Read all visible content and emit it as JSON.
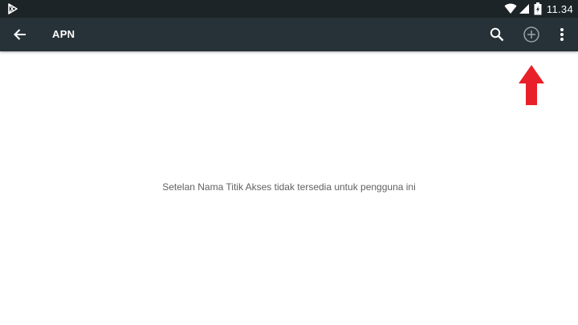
{
  "status_bar": {
    "time": "11.34",
    "icons": [
      "play-store-icon",
      "wifi-icon",
      "cellular-signal-icon",
      "battery-charging-icon"
    ]
  },
  "app_bar": {
    "title": "APN",
    "background": "#263238",
    "actions": [
      "back-arrow-icon",
      "search-icon",
      "add-circle-icon",
      "more-vert-icon"
    ]
  },
  "main": {
    "empty_message": "Setelan Nama Titik Akses tidak tersedia untuk pengguna ini"
  },
  "annotation": {
    "type": "arrow-up",
    "color": "#e8202a"
  }
}
